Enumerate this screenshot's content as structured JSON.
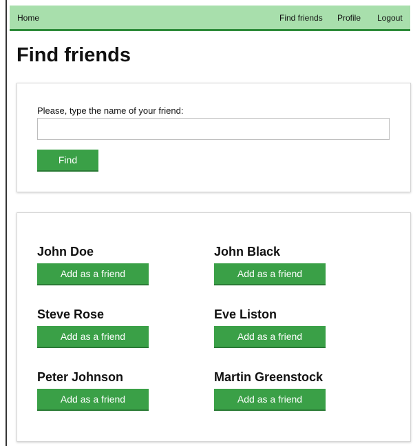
{
  "nav": {
    "home": "Home",
    "find_friends": "Find friends",
    "profile": "Profile",
    "logout": "Logout"
  },
  "page": {
    "title": "Find friends"
  },
  "search": {
    "label": "Please, type the name of your friend:",
    "value": "",
    "placeholder": "",
    "button_label": "Find"
  },
  "results": [
    {
      "name": "John Doe",
      "action": "Add as a friend"
    },
    {
      "name": "John Black",
      "action": "Add as a friend"
    },
    {
      "name": "Steve Rose",
      "action": "Add as a friend"
    },
    {
      "name": "Eve Liston",
      "action": "Add as a friend"
    },
    {
      "name": "Peter Johnson",
      "action": "Add as a friend"
    },
    {
      "name": "Martin Greenstock",
      "action": "Add as a friend"
    }
  ],
  "colors": {
    "navbar_bg": "#a8dfac",
    "navbar_border": "#2e8b3a",
    "button_bg": "#3aa047",
    "button_text": "#ffffff"
  }
}
